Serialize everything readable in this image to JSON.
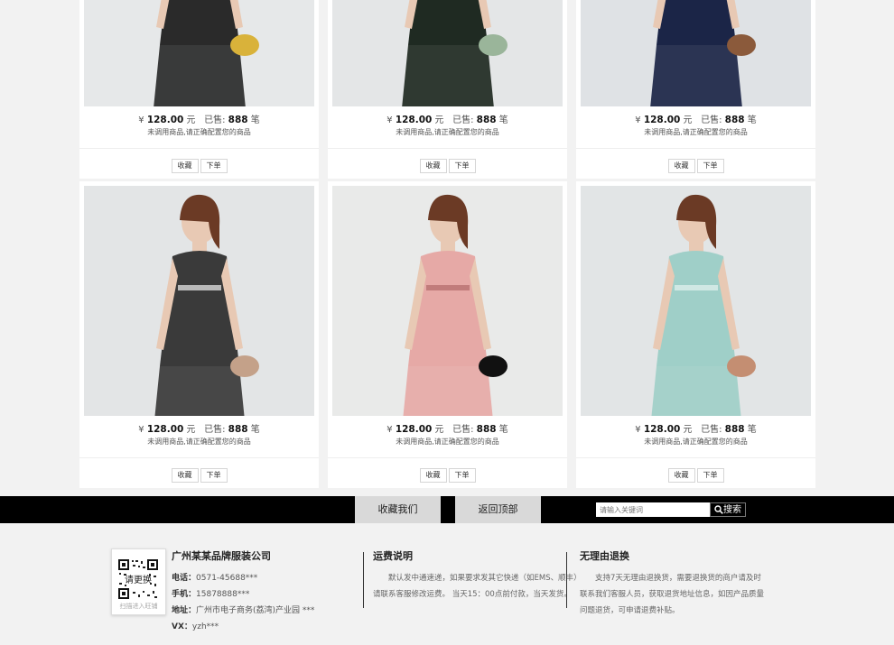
{
  "products": [
    {
      "price": "128.00",
      "currency": "¥",
      "unit": "元",
      "sold_label": "已售:",
      "sold": "888",
      "sold_unit": "笔",
      "desc": "未调用商品,请正确配置您的商品",
      "fav": "收藏",
      "order": "下单",
      "outfit": "plaid-dress"
    },
    {
      "price": "128.00",
      "currency": "¥",
      "unit": "元",
      "sold_label": "已售:",
      "sold": "888",
      "sold_unit": "笔",
      "desc": "未调用商品,请正确配置您的商品",
      "fav": "收藏",
      "order": "下单",
      "outfit": "floral-skirt"
    },
    {
      "price": "128.00",
      "currency": "¥",
      "unit": "元",
      "sold_label": "已售:",
      "sold": "888",
      "sold_unit": "笔",
      "desc": "未调用商品,请正确配置您的商品",
      "fav": "收藏",
      "order": "下单",
      "outfit": "white-top"
    },
    {
      "price": "128.00",
      "currency": "¥",
      "unit": "元",
      "sold_label": "已售:",
      "sold": "888",
      "sold_unit": "笔",
      "desc": "未调用商品,请正确配置您的商品",
      "fav": "收藏",
      "order": "下单",
      "outfit": "plaid-dress-back"
    },
    {
      "price": "128.00",
      "currency": "¥",
      "unit": "元",
      "sold_label": "已售:",
      "sold": "888",
      "sold_unit": "笔",
      "desc": "未调用商品,请正确配置您的商品",
      "fav": "收藏",
      "order": "下单",
      "outfit": "pink-blazer"
    },
    {
      "price": "128.00",
      "currency": "¥",
      "unit": "元",
      "sold_label": "已售:",
      "sold": "888",
      "sold_unit": "笔",
      "desc": "未调用商品,请正确配置您的商品",
      "fav": "收藏",
      "order": "下单",
      "outfit": "mint-lace-dress"
    }
  ],
  "bar": {
    "favorite_us": "收藏我们",
    "back_to_top": "返回顶部",
    "search_placeholder": "请输入关键词",
    "search_button": "搜索"
  },
  "footer": {
    "qr_text": "请更换",
    "qr_caption": "扫描进入旺铺",
    "company_name": "广州某某品牌服装公司",
    "phone_label": "电话：",
    "phone": "0571-45688***",
    "mobile_label": "手机：",
    "mobile": "15878888***",
    "address_label": "地址：",
    "address": "广州市电子商务(荔湾)产业园 ***",
    "vx_label": "VX：",
    "vx": "yzh***",
    "shipping_title": "运费说明",
    "shipping_text": "默认发中通速递，如果要求发其它快递（如EMS、顺丰）请联系客服修改运费。 当天15：00点前付款，当天发货。",
    "returns_title": "无理由退换",
    "returns_text": "支持7天无理由退换货，需要退换货的商户请及时联系我们客服人员，获取退货地址信息，如因产品质量问题退货，可申请退费补贴。"
  },
  "colors": {
    "bar": "#000000",
    "bar_button": "#d9d9d9",
    "page_bg": "#f2f2f2"
  }
}
